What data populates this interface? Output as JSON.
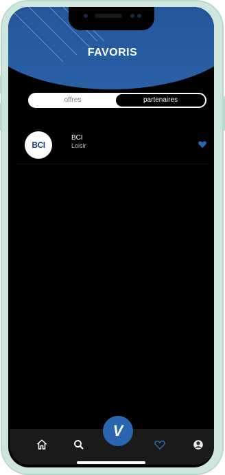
{
  "header": {
    "title": "FAVORIS"
  },
  "toggle": {
    "option_offres": "offres",
    "option_partenaires": "partenaires",
    "selected": "partenaires"
  },
  "favorites": [
    {
      "logo_text": "BCI",
      "name": "BCI",
      "category": "Loisir",
      "favorited": true
    }
  ],
  "bottom_nav": {
    "items": [
      "home-icon",
      "search-icon",
      "app-logo",
      "heart-icon",
      "profile-icon"
    ],
    "center_label": "V",
    "active": "heart-icon"
  },
  "colors": {
    "accent": "#2a67b0",
    "header": "#1e4c8c",
    "background": "#000000"
  }
}
